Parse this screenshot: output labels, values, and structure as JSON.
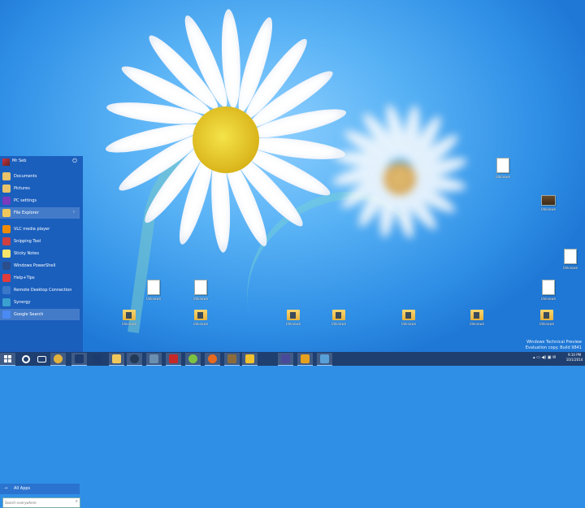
{
  "start_menu": {
    "user_name": "Mr Seb",
    "items": [
      {
        "label": "Documents",
        "icon": "documents-icon",
        "color": "#e8c36a"
      },
      {
        "label": "Pictures",
        "icon": "pictures-icon",
        "color": "#e8c36a"
      },
      {
        "label": "PC settings",
        "icon": "gear-icon",
        "color": "#7a3bbf"
      },
      {
        "label": "File Explorer",
        "icon": "folder-icon",
        "color": "#f0c75a"
      },
      {
        "label": "VLC media player",
        "icon": "vlc-icon",
        "color": "#f08a00"
      },
      {
        "label": "Snipping Tool",
        "icon": "scissors-icon",
        "color": "#d04040"
      },
      {
        "label": "Sticky Notes",
        "icon": "sticky-notes-icon",
        "color": "#f5e56b"
      },
      {
        "label": "Windows PowerShell",
        "icon": "powershell-icon",
        "color": "#2b4e8c"
      },
      {
        "label": "Help+Tips",
        "icon": "help-icon",
        "color": "#e03c3c"
      },
      {
        "label": "Remote Desktop Connection",
        "icon": "remote-desktop-icon",
        "color": "#3a78c9"
      },
      {
        "label": "Synergy",
        "icon": "synergy-icon",
        "color": "#3aa0d0"
      },
      {
        "label": "Google Search",
        "icon": "google-search-icon",
        "color": "#4a8af4"
      }
    ],
    "all_apps_label": "All Apps",
    "search_placeholder": "Search everywhere"
  },
  "desktop_icons": [
    {
      "label": "Unknown",
      "type": "file"
    },
    {
      "label": "Unknown",
      "type": "file"
    },
    {
      "label": "Unknown",
      "type": "file"
    },
    {
      "label": "Unknown",
      "type": "image"
    },
    {
      "label": "Unknown",
      "type": "file"
    },
    {
      "label": "Unknown",
      "type": "file"
    },
    {
      "label": "Unknown",
      "type": "folder"
    },
    {
      "label": "Unknown",
      "type": "folder"
    },
    {
      "label": "Unknown",
      "type": "folder"
    },
    {
      "label": "Unknown",
      "type": "folder"
    },
    {
      "label": "Unknown",
      "type": "folder"
    },
    {
      "label": "Unknown",
      "type": "folder"
    },
    {
      "label": "Unknown",
      "type": "folder"
    },
    {
      "label": "Unknown",
      "type": "folder"
    }
  ],
  "taskbar": {
    "buttons": [
      {
        "icon": "search-icon",
        "color": "#ffffff"
      },
      {
        "icon": "task-view-icon",
        "color": "#ffffff"
      },
      {
        "icon": "chrome-icon",
        "color": "#e3b23c"
      },
      {
        "icon": "photoshop-icon",
        "color": "#1d3b6e"
      },
      {
        "icon": "photoshop-icon",
        "color": "#1d3b6e"
      },
      {
        "icon": "file-explorer-icon",
        "color": "#f0c75a"
      },
      {
        "icon": "steam-icon",
        "color": "#223a55"
      },
      {
        "icon": "app-icon",
        "color": "#6b8fb0"
      },
      {
        "icon": "filezilla-icon",
        "color": "#c62828"
      },
      {
        "icon": "spotify-icon",
        "color": "#7cc243"
      },
      {
        "icon": "firefox-icon",
        "color": "#e86a1f"
      },
      {
        "icon": "app-icon",
        "color": "#8c6b3a"
      },
      {
        "icon": "app-icon",
        "color": "#f2c12e"
      },
      {
        "icon": "app-icon",
        "color": "#4a4a9a"
      },
      {
        "icon": "app-icon",
        "color": "#e6a020"
      },
      {
        "icon": "app-icon",
        "color": "#5aa0d8"
      }
    ],
    "time": "9:10 PM",
    "date": "10/1/2014"
  },
  "watermark": {
    "line1": "Windows Technical Preview",
    "line2": "Evaluation copy. Build 9841"
  },
  "colors": {
    "accent": "#1b5fbd",
    "taskbar": "#1f3f70"
  }
}
